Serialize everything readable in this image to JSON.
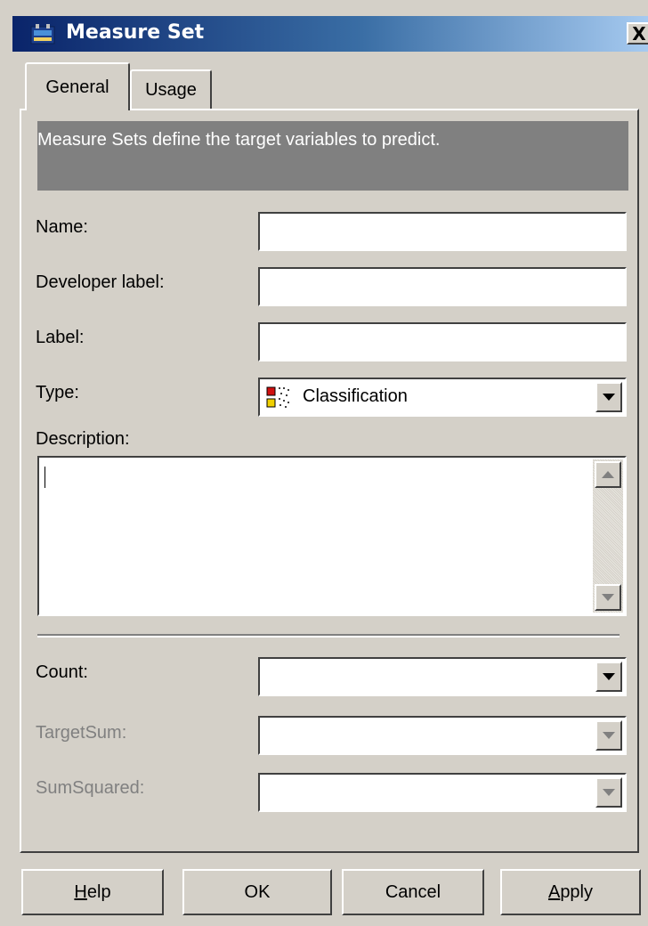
{
  "window": {
    "title": "Measure Set",
    "close_glyph": "X",
    "title_icon": "measure-set-icon"
  },
  "tabs": [
    {
      "label": "General",
      "active": true
    },
    {
      "label": "Usage",
      "active": false
    }
  ],
  "info_text": "Measure Sets define the target variables to predict.",
  "fields": {
    "name": {
      "label": "Name:",
      "value": ""
    },
    "developer_label": {
      "label": "Developer label:",
      "value": ""
    },
    "label": {
      "label": "Label:",
      "value": ""
    },
    "type": {
      "label": "Type:",
      "value": "Classification",
      "icon": "classification-icon"
    },
    "description": {
      "label": "Description:",
      "value": ""
    },
    "count": {
      "label": "Count:",
      "value": "",
      "enabled": true
    },
    "target_sum": {
      "label": "TargetSum:",
      "value": "",
      "enabled": false
    },
    "sum_squared": {
      "label": "SumSquared:",
      "value": "",
      "enabled": false
    }
  },
  "buttons": {
    "help": {
      "label": "Help",
      "mnemonic": "H"
    },
    "ok": {
      "label": "OK"
    },
    "cancel": {
      "label": "Cancel"
    },
    "apply": {
      "label": "Apply",
      "mnemonic": "A"
    }
  },
  "colors": {
    "face": "#d4d0c8",
    "title_start": "#0a246a",
    "title_end": "#a6caf0",
    "info_bg": "#808080",
    "disabled_text": "#808080"
  }
}
